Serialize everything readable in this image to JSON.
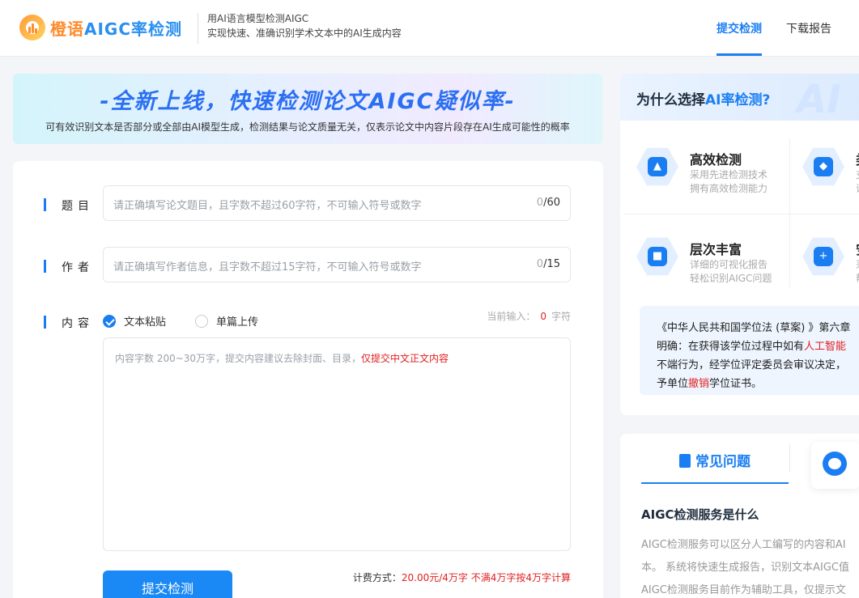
{
  "header": {
    "logo_text_cn": "橙语",
    "logo_text_en": "AIGC率检测",
    "slogan_line1": "用AI语言模型检测AIGC",
    "slogan_line2": "实现快速、准确识别学术文本中的AI生成内容",
    "nav": [
      {
        "label": "提交检测",
        "active": true
      },
      {
        "label": "下载报告",
        "active": false
      }
    ]
  },
  "banner": {
    "title": "-全新上线，快速检测论文AIGC疑似率-",
    "subtitle": "可有效识别文本是否部分或全部由AI模型生成，检测结果与论文质量无关，仅表示论文中内容片段存在AI生成可能性的概率"
  },
  "form": {
    "title_label": "题目",
    "title_placeholder": "请正确填写论文题目，且字数不超过60字符，不可输入符号或数字",
    "title_count_current": "0",
    "title_count_max": "/60",
    "author_label": "作者",
    "author_placeholder": "请正确填写作者信息，且字数不超过15字符，不可输入符号或数字",
    "author_count_current": "0",
    "author_count_max": "/15",
    "content_label": "内容",
    "mode_options": [
      {
        "label": "文本粘贴",
        "selected": true
      },
      {
        "label": "单篇上传",
        "selected": false
      }
    ],
    "current_input_label": "当前输入：",
    "current_input_value": "0",
    "current_input_unit": "字符",
    "content_placeholder": "内容字数 200~30万字，提交内容建议去除封面、目录，",
    "content_placeholder_red": "仅提交中文正文内容",
    "submit_label": "提交检测",
    "fee_label": "计费方式：",
    "fee_value": "20.00元/4万字 不满4万字按4万字计算"
  },
  "why": {
    "title_prefix": "为什么选择",
    "title_highlight": "AI率检测?",
    "watermark": "AI",
    "features": [
      {
        "icon": "rocket-icon",
        "title": "高效检测",
        "desc1": "采用先进检测技术",
        "desc2": "拥有高效检测能力"
      },
      {
        "icon": "cubes-icon",
        "title": "类",
        "desc1": "支",
        "desc2": "识"
      },
      {
        "icon": "layers-icon",
        "title": "层次丰富",
        "desc1": "详细的可视化报告",
        "desc2": "轻松识别AIGC问题"
      },
      {
        "icon": "shield-icon",
        "title": "安",
        "desc1": "采",
        "desc2": "帮"
      }
    ],
    "law_line1": "《中华人民共和国学位法 (草案) 》第六章",
    "law_line2_prefix": "明确：在获得该学位过程中如有",
    "law_line2_red": "人工智能",
    "law_line3": "不端行为，经学位评定委员会审议决定，",
    "law_line4_prefix": "予单位",
    "law_line4_red": "撤销",
    "law_line4_suffix": "学位证书。"
  },
  "faq": {
    "tab_label": "常见问题",
    "question": "AIGC检测服务是什么",
    "answer_line1": "AIGC检测服务可以区分人工编写的内容和AI",
    "answer_line2": "本。 系统将快速生成报告，识别文本AIGC值",
    "answer_line3": "AIGC检测服务目前作为辅助工具，仅提示文"
  }
}
